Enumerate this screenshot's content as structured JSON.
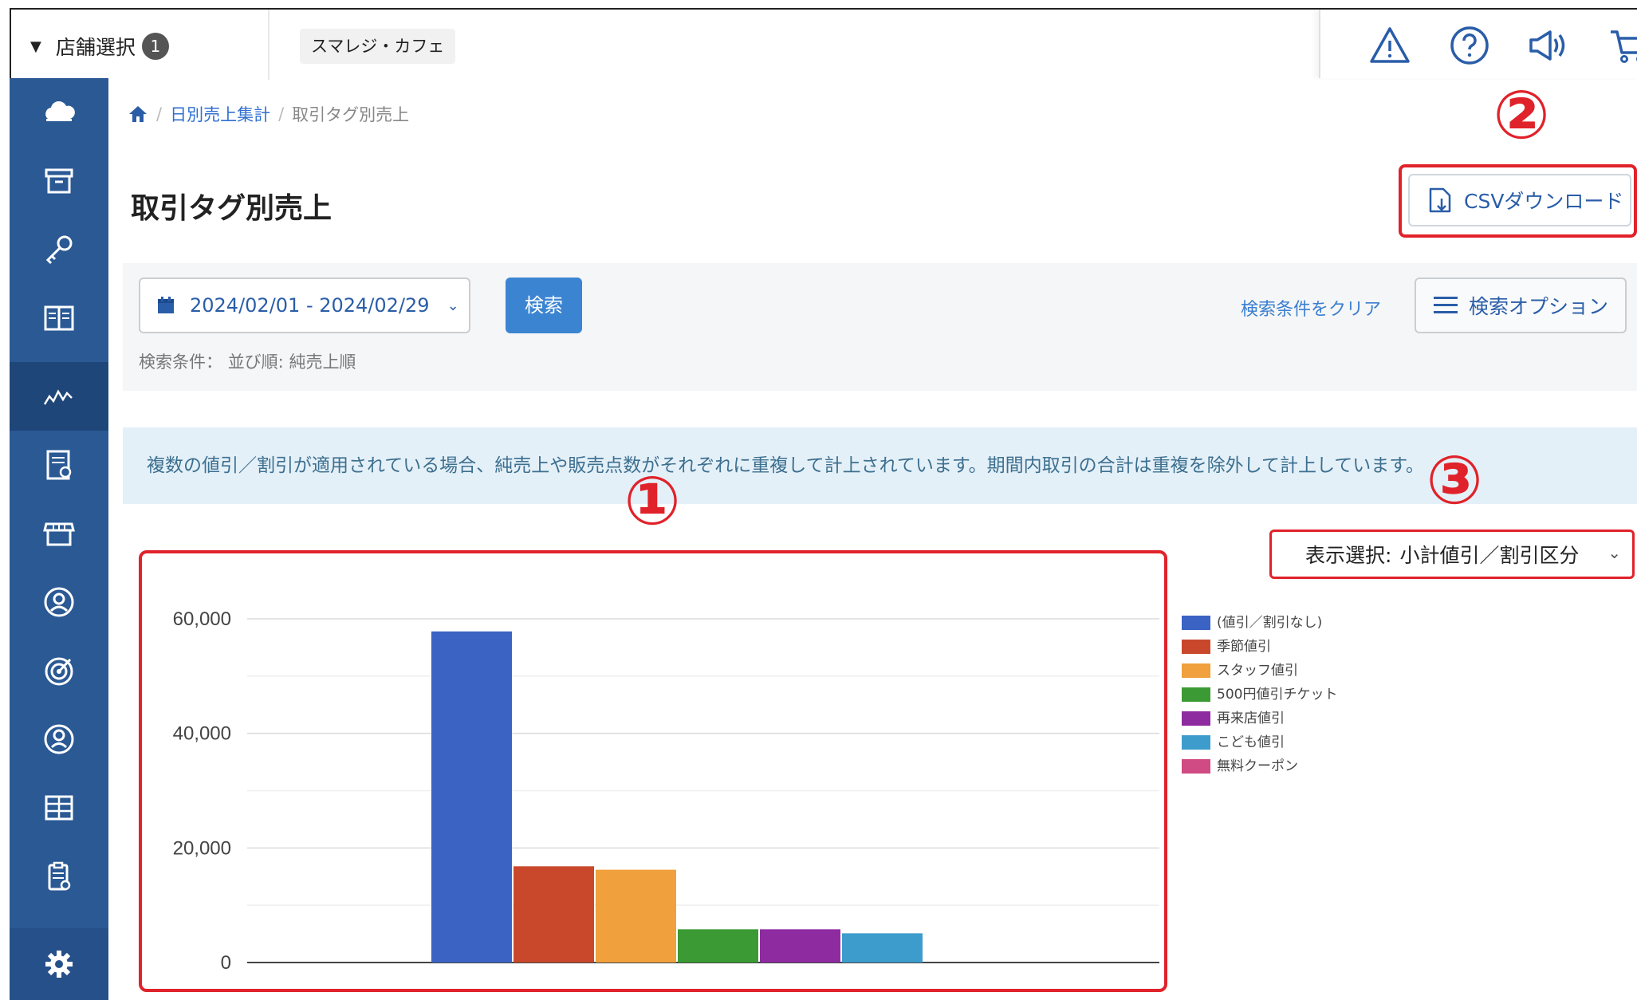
{
  "topbar": {
    "store_select_label": "店舗選択",
    "store_count": "1",
    "current_store": "スマレジ・カフェ"
  },
  "breadcrumb": {
    "parent": "日別売上集計",
    "current": "取引タグ別売上"
  },
  "page": {
    "title": "取引タグ別売上",
    "csv_button": "CSVダウンロード"
  },
  "search": {
    "date_range": "2024/02/01 - 2024/02/29",
    "search_button": "検索",
    "conditions_label": "検索条件：",
    "conditions_value": "並び順: 純売上順",
    "clear_link": "検索条件をクリア",
    "options_button": "検索オプション"
  },
  "notice": "複数の値引／割引が適用されている場合、純売上や販売点数がそれぞれに重複して計上されています。期間内取引の合計は重複を除外して計上しています。",
  "display_select": {
    "label": "表示選択:",
    "value": "小計値引／割引区分"
  },
  "annotations": [
    "①",
    "②",
    "③"
  ],
  "sidebar_icons": [
    "cloud-icon",
    "archive-icon",
    "key-icon",
    "book-icon",
    "chart-icon",
    "report-icon",
    "store-icon",
    "user-circle-icon",
    "target-icon",
    "member-icon",
    "grid-icon",
    "clipboard-icon",
    "gear-icon"
  ],
  "chart_data": {
    "type": "bar",
    "categories": [
      "(値引／割引なし)",
      "季節値引",
      "スタッフ値引",
      "500円値引チケット",
      "再来店値引",
      "こども値引",
      "無料クーポン"
    ],
    "values": [
      57800,
      16800,
      16200,
      5800,
      5800,
      5100,
      0
    ],
    "colors": [
      "#3a63c4",
      "#c9482b",
      "#f0a03c",
      "#3c9a34",
      "#8e2ba0",
      "#3d9ccc",
      "#d04a83"
    ],
    "ylim": [
      0,
      60000
    ],
    "yticks": [
      "0",
      "20,000",
      "40,000",
      "60,000"
    ],
    "legend_position": "right",
    "grid": true
  }
}
